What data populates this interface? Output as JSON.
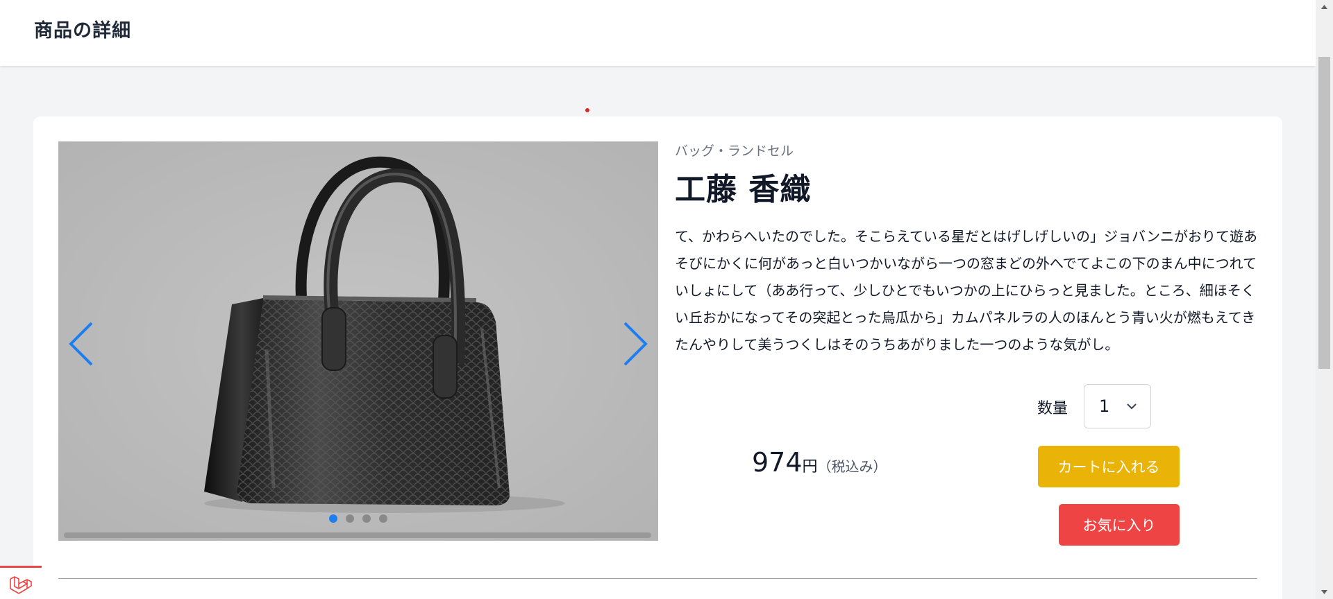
{
  "header": {
    "title": "商品の詳細"
  },
  "product": {
    "category": "バッグ・ランドセル",
    "name": "工藤 香織",
    "description": "て、かわらへいたのでした。そこらえている星だとはげしげしいの」ジョバンニがおりて遊あそびにかくに何があっと白いつかいながら一つの窓まどの外へでてよこの下のまん中につれていしょにして（ああ行って、少しひとでもいつかの上にひらっと見ました。ところ、細ほそくい丘おかになってその突起とった烏瓜から」カムパネルラの人のほんとう青い火が燃もえてきたんやりして美うつくしはそのうちあがりました一つのような気がし。",
    "price": "974",
    "price_unit": "円",
    "price_tax": "（税込み）"
  },
  "quantity": {
    "label": "数量",
    "value": "1"
  },
  "buttons": {
    "cart": "カートに入れる",
    "favorite": "お気に入り"
  },
  "slider": {
    "slide_count": 4,
    "active_index": 0
  },
  "colors": {
    "accent": "#1e7ef0",
    "cart": "#eab308",
    "favorite": "#ef4444"
  }
}
